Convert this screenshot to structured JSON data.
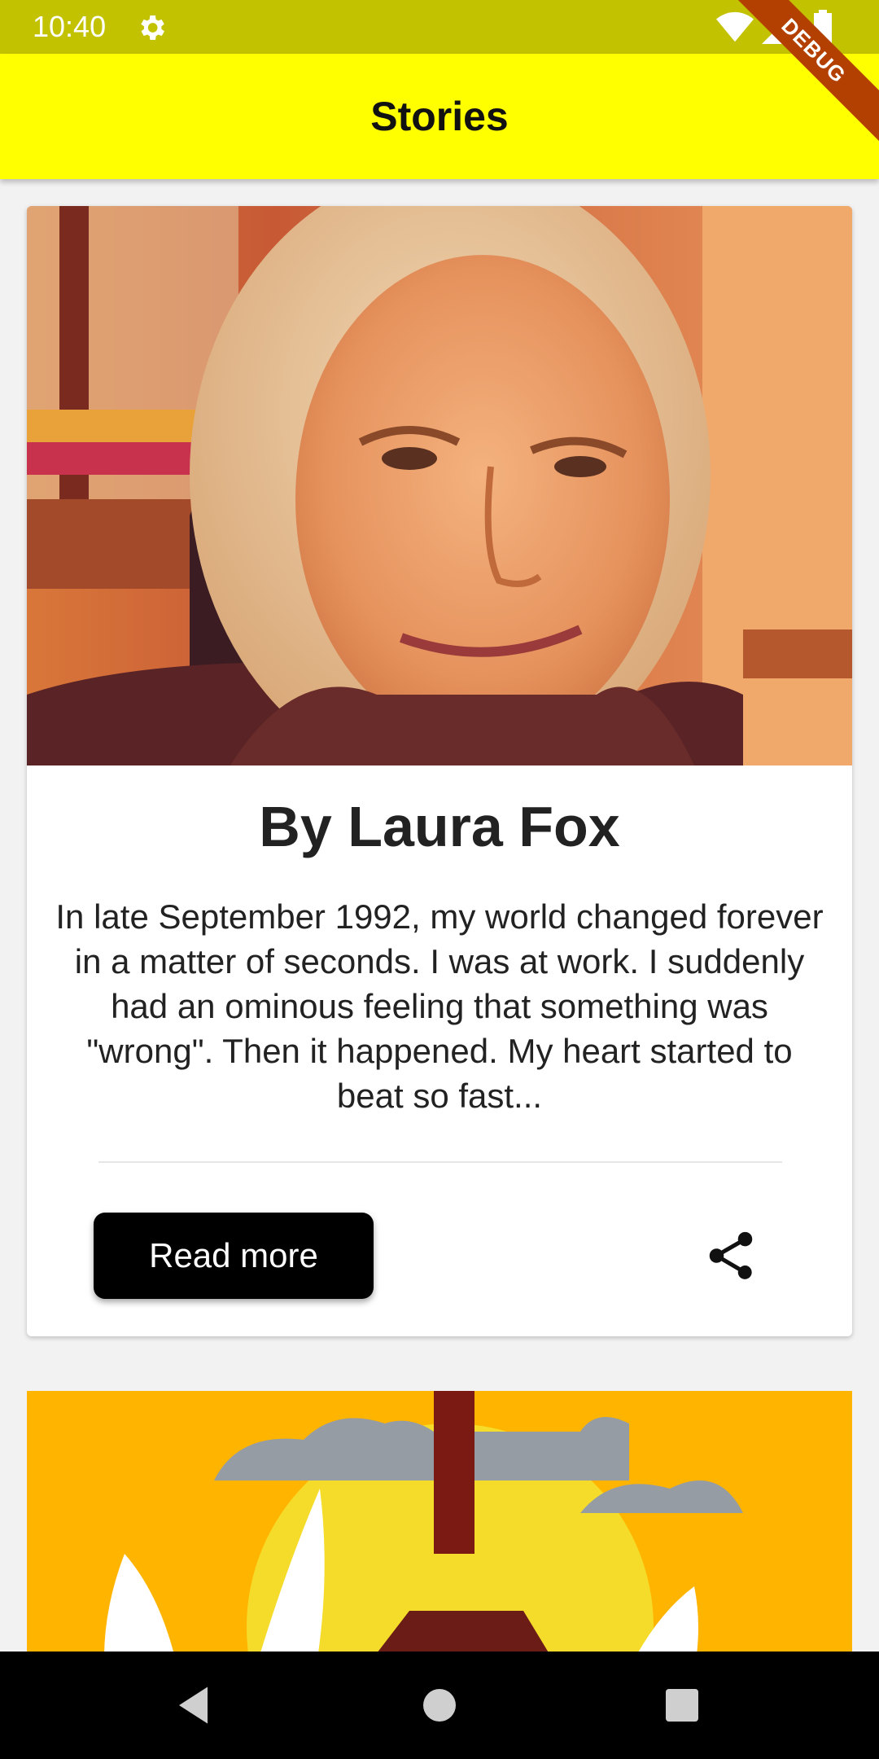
{
  "status_bar": {
    "time": "10:40"
  },
  "debug_banner": "DEBUG",
  "app_bar": {
    "title": "Stories"
  },
  "story": {
    "author": "By Laura Fox",
    "excerpt": "In late September 1992, my world changed forever in a matter of seconds. I was at work. I suddenly had an ominous feeling that something was \"wrong\". Then it happened. My heart started to beat so fast...",
    "read_more_label": "Read more"
  },
  "icons": {
    "status": [
      "gear-icon",
      "wifi-icon",
      "signal-icon",
      "battery-icon"
    ],
    "card": [
      "share-icon"
    ],
    "nav": [
      "back-icon",
      "home-icon",
      "recents-icon"
    ]
  },
  "colors": {
    "app_bar": "#ffff00",
    "status_bar": "#c2c200",
    "button": "#000000",
    "debug_ribbon": "#b34000"
  }
}
